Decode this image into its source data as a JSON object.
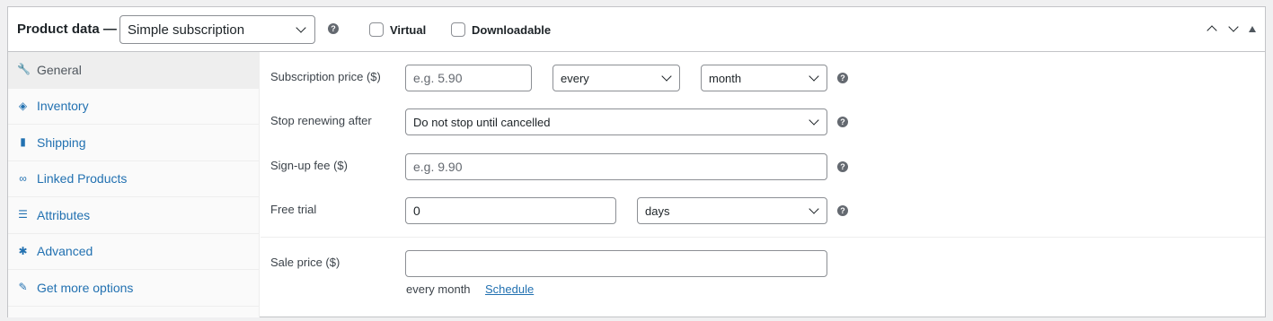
{
  "header": {
    "title": "Product data —",
    "product_type": "Simple subscription",
    "virtual_label": "Virtual",
    "downloadable_label": "Downloadable",
    "help_glyph": "?"
  },
  "tabs": [
    {
      "label": "General",
      "icon": "wrench-icon",
      "active": true
    },
    {
      "label": "Inventory",
      "icon": "tag-icon",
      "active": false
    },
    {
      "label": "Shipping",
      "icon": "truck-icon",
      "active": false
    },
    {
      "label": "Linked Products",
      "icon": "link-icon",
      "active": false
    },
    {
      "label": "Attributes",
      "icon": "list-icon",
      "active": false
    },
    {
      "label": "Advanced",
      "icon": "gear-icon",
      "active": false
    },
    {
      "label": "Get more options",
      "icon": "plugin-icon",
      "active": false
    }
  ],
  "fields": {
    "subscription_price": {
      "label": "Subscription price ($)",
      "placeholder": "e.g. 5.90",
      "interval": "every",
      "period": "month"
    },
    "stop_renewing": {
      "label": "Stop renewing after",
      "value": "Do not stop until cancelled"
    },
    "signup_fee": {
      "label": "Sign-up fee ($)",
      "placeholder": "e.g. 9.90"
    },
    "free_trial": {
      "label": "Free trial",
      "value": "0",
      "unit": "days"
    },
    "sale_price": {
      "label": "Sale price ($)",
      "value": "",
      "period_text": "every month",
      "schedule_link": "Schedule"
    }
  },
  "colors": {
    "accent": "#2271b1",
    "border": "#8c8f94",
    "active_tab_bg": "#eeeeee"
  }
}
